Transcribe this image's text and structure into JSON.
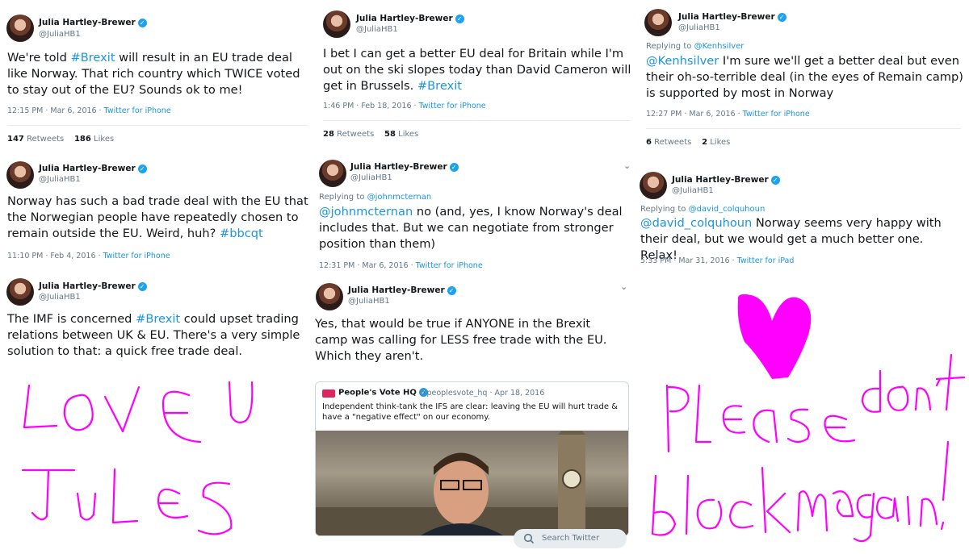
{
  "author": {
    "name": "Julia Hartley-Brewer",
    "handle": "@JuliaHB1"
  },
  "tweets": [
    {
      "text_html": "We're told <span class='lk'>#Brexit</span> will result in an EU trade deal like Norway. That rich country which TWICE voted to stay out of the EU? Sounds ok to me!",
      "time": "12:15 PM · Mar 6, 2016",
      "source": "Twitter for iPhone",
      "retweets": "147",
      "retweets_label": "Retweets",
      "likes": "186",
      "likes_label": "Likes"
    },
    {
      "text_html": "I bet I can get a better EU deal for Britain while I'm out on the ski slopes today than David Cameron will get in Brussels. <span class='lk'>#Brexit</span>",
      "time": "1:46 PM · Feb 18, 2016",
      "source": "Twitter for iPhone",
      "retweets": "28",
      "retweets_label": "Retweets",
      "likes": "58",
      "likes_label": "Likes"
    },
    {
      "reply_prefix": "Replying to",
      "reply_to": "@Kenhsilver",
      "text_html": "<span class='lk'>@Kenhsilver</span> I'm sure we'll get a better deal but even their oh-so-terrible deal (in the eyes of Remain camp) is supported by most in Norway",
      "time": "12:27 PM · Mar 6, 2016",
      "source": "Twitter for iPhone",
      "retweets": "6",
      "retweets_label": "Retweets",
      "likes": "2",
      "likes_label": "Likes"
    },
    {
      "text_html": "Norway has such a bad trade deal with the EU that the Norwegian people have repeatedly chosen to remain outside the EU. Weird, huh? <span class='lk'>#bbcqt</span>",
      "time": "11:10 PM · Feb 4, 2016",
      "source": "Twitter for iPhone"
    },
    {
      "reply_prefix": "Replying to",
      "reply_to": "@johnmcternan",
      "text_html": "<span class='lk'>@johnmcternan</span> no (and, yes, I know Norway's deal includes that. But we can negotiate from stronger position than them)",
      "time": "12:31 PM · Mar 6, 2016",
      "source": "Twitter for iPhone"
    },
    {
      "reply_prefix": "Replying to",
      "reply_to": "@david_colquhoun",
      "text_html": "<span class='lk'>@david_colquhoun</span> Norway seems very happy with their deal, but we would get a much better one. Relax!",
      "time": "5:33 PM · Mar 31, 2016",
      "source": "Twitter for iPad"
    },
    {
      "text_html": "The IMF is concerned <span class='lk'>#Brexit</span> could upset trading relations between UK &amp; EU. There's a very simple solution to that: a quick free trade deal."
    },
    {
      "text_html": "Yes, that would be true if ANYONE in the Brexit camp was calling for LESS free trade with the EU. Which they aren't."
    }
  ],
  "quote": {
    "name": "People's Vote HQ",
    "handle": "@peoplesvote_hq · Apr 18, 2016",
    "text": "Independent think-tank the IFS are clear: leaving the EU will hurt trade & have a \"negative effect\" on our economy."
  },
  "search_placeholder": "Search Twitter",
  "scrawls": {
    "color": "#ff00ff",
    "left": [
      "Love U",
      "Jules"
    ],
    "right": [
      "Please",
      "don't",
      "block me",
      "again!"
    ],
    "heart": "heart"
  }
}
